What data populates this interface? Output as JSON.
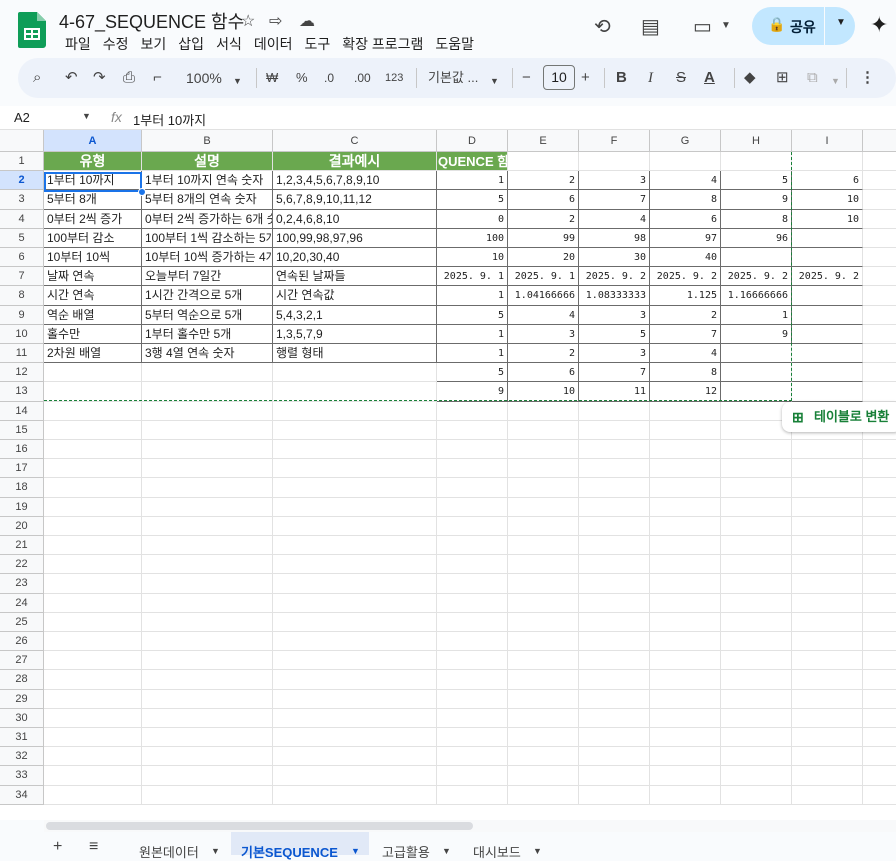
{
  "doc_title": "4-67_SEQUENCE 함수",
  "menu": [
    "파일",
    "수정",
    "보기",
    "삽입",
    "서식",
    "데이터",
    "도구",
    "확장 프로그램",
    "도움말"
  ],
  "share_label": "공유",
  "toolbar": {
    "zoom": "100%",
    "currency": "₩",
    "percent": "%",
    "dec_minus": ".0",
    "dec_plus": ".00",
    "number_format": "123",
    "font": "기본값 ...",
    "font_size": "10"
  },
  "formula_bar": {
    "name_box": "A2",
    "fx": "fx",
    "content": "1부터 10까지"
  },
  "column_headers": [
    "A",
    "B",
    "C",
    "D",
    "E",
    "F",
    "G",
    "H",
    "I"
  ],
  "row_headers": [
    "1",
    "2",
    "3",
    "4",
    "5",
    "6",
    "7",
    "8",
    "9",
    "10",
    "11",
    "12",
    "13",
    "14",
    "15",
    "16",
    "17",
    "18",
    "19",
    "20",
    "21",
    "22",
    "23",
    "24",
    "25",
    "26",
    "27",
    "28",
    "29",
    "30",
    "31",
    "32",
    "33",
    "34"
  ],
  "header_row": [
    "유형",
    "설명",
    "결과예시",
    "QUENCE 함"
  ],
  "rows": [
    [
      "1부터 10까지",
      "1부터 10까지 연속 숫자",
      "1,2,3,4,5,6,7,8,9,10"
    ],
    [
      "5부터 8개",
      "5부터 8개의 연속 숫자",
      "5,6,7,8,9,10,11,12"
    ],
    [
      "0부터 2씩 증가",
      "0부터 2씩 증가하는 6개 숫",
      "0,2,4,6,8,10"
    ],
    [
      "100부터 감소",
      "100부터 1씩 감소하는 5개",
      "100,99,98,97,96"
    ],
    [
      "10부터 10씩",
      "10부터 10씩 증가하는 4개",
      "10,20,30,40"
    ],
    [
      "날짜 연속",
      "오늘부터 7일간",
      "연속된 날짜들"
    ],
    [
      "시간 연속",
      "1시간 간격으로 5개",
      "시간 연속값"
    ],
    [
      "역순 배열",
      "5부터 역순으로 5개",
      "5,4,3,2,1"
    ],
    [
      "홀수만",
      "1부터 홀수만 5개",
      "1,3,5,7,9"
    ],
    [
      "2차원 배열",
      "3행 4열 연속 숫자",
      "행렬 형태"
    ]
  ],
  "values": [
    [
      "1",
      "2",
      "3",
      "4",
      "5",
      "6"
    ],
    [
      "5",
      "6",
      "7",
      "8",
      "9",
      "10"
    ],
    [
      "0",
      "2",
      "4",
      "6",
      "8",
      "10"
    ],
    [
      "100",
      "99",
      "98",
      "97",
      "96",
      ""
    ],
    [
      "10",
      "20",
      "30",
      "40",
      "",
      ""
    ],
    [
      "2025. 9. 1",
      "2025. 9. 1",
      "2025. 9. 2",
      "2025. 9. 2",
      "2025. 9. 2",
      "2025. 9. 2"
    ],
    [
      "1",
      "1.04166666",
      "1.08333333",
      "1.125",
      "1.16666666",
      ""
    ],
    [
      "5",
      "4",
      "3",
      "2",
      "1",
      ""
    ],
    [
      "1",
      "3",
      "5",
      "7",
      "9",
      ""
    ],
    [
      "1",
      "2",
      "3",
      "4",
      "",
      ""
    ],
    [
      "5",
      "6",
      "7",
      "8",
      "",
      ""
    ],
    [
      "9",
      "10",
      "11",
      "12",
      "",
      ""
    ]
  ],
  "convert_table_label": "테이블로 변환",
  "sheet_tabs": [
    "원본데이터",
    "기본SEQUENCE",
    "고급활용",
    "대시보드"
  ],
  "colors": {
    "header_green": "#6aa84f",
    "selection_blue": "#1a73e8",
    "share_bg": "#c2e7ff"
  }
}
